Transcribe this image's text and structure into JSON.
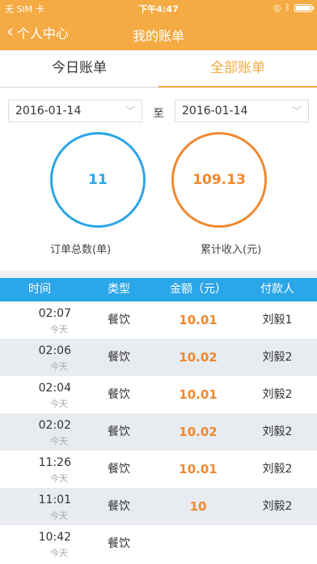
{
  "status": {
    "carrier": "无 SIM 卡",
    "time": "下午4:47"
  },
  "nav": {
    "back_label": "个人中心",
    "title": "我的账单"
  },
  "tabs": [
    {
      "label": "今日账单",
      "active": false
    },
    {
      "label": "全部账单",
      "active": true
    }
  ],
  "filter": {
    "date_from": "2016-01-14",
    "separator": "至",
    "date_to": "2016-01-14"
  },
  "summary": {
    "order_count": "11",
    "order_count_label": "订单总数(单)",
    "income": "109.13",
    "income_label": "累计收入(元)"
  },
  "table": {
    "headers": [
      "时间",
      "类型",
      "金额（元）",
      "付款人"
    ],
    "rows": [
      {
        "time": "02:07",
        "day": "今天",
        "type": "餐饮",
        "amount": "10.01",
        "payer": "刘毅1"
      },
      {
        "time": "02:06",
        "day": "今天",
        "type": "餐饮",
        "amount": "10.02",
        "payer": "刘毅2"
      },
      {
        "time": "02:04",
        "day": "今天",
        "type": "餐饮",
        "amount": "10.01",
        "payer": "刘毅2"
      },
      {
        "time": "02:02",
        "day": "今天",
        "type": "餐饮",
        "amount": "10.02",
        "payer": "刘毅2"
      },
      {
        "time": "11:26",
        "day": "今天",
        "type": "餐饮",
        "amount": "10.01",
        "payer": "刘毅2"
      },
      {
        "time": "11:01",
        "day": "今天",
        "type": "餐饮",
        "amount": "10",
        "payer": "刘毅2"
      },
      {
        "time": "10:42",
        "day": "今天",
        "type": "餐饮",
        "amount": "",
        "payer": ""
      }
    ]
  },
  "colors": {
    "accent": "#f5ab43",
    "blue": "#2ba6e8",
    "orange": "#f0892e"
  }
}
